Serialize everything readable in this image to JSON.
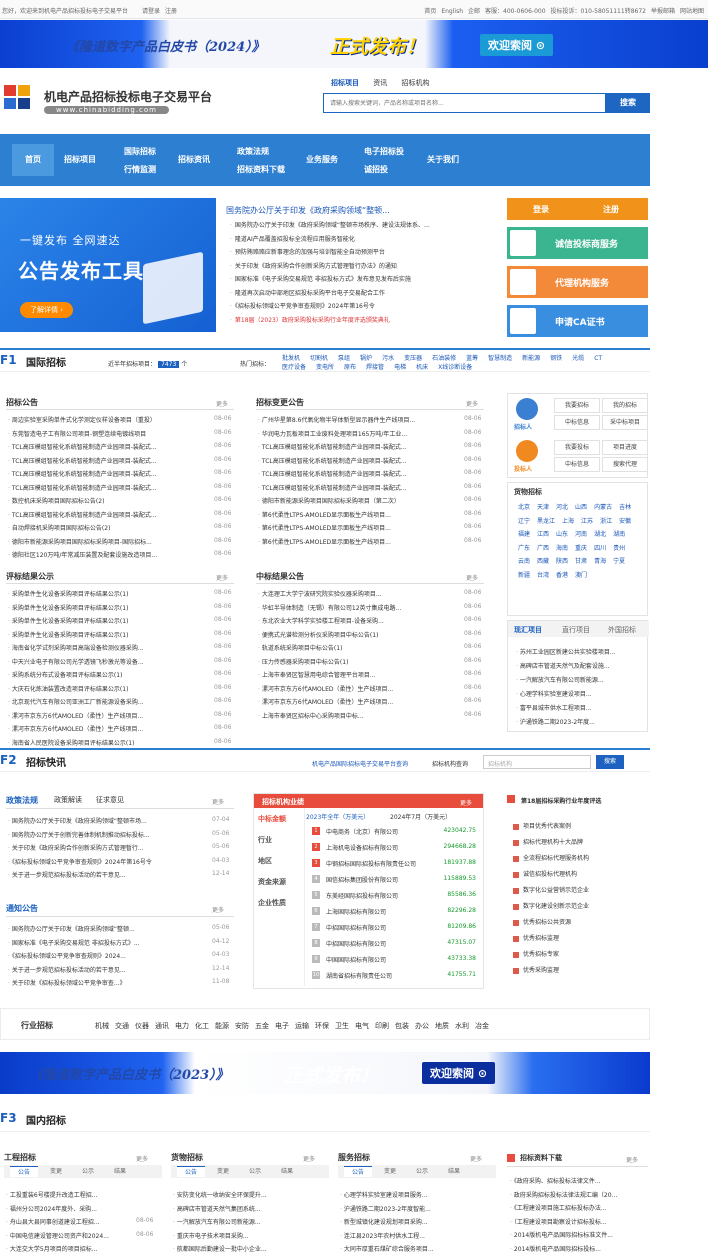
{
  "topbar": {
    "welcome": "您好，欢迎来到机电产品招标投标电子交易平台",
    "login": "请登录",
    "register": "注册",
    "links": [
      "首页",
      "English",
      "企邮",
      "客服：400-0606-000",
      "投标投诉：010-58051111转8672",
      "举报邮箱",
      "网站地图"
    ]
  },
  "banner_top": {
    "title": "《隆道数字产品白皮书（2024）》",
    "big": "正式发布！",
    "button": "欢迎索阅 ⊙"
  },
  "logo": {
    "name": "机电产品招标投标电子交易平台",
    "url": "www.chinabidding.com"
  },
  "search": {
    "tabs": [
      "招标项目",
      "资讯",
      "招标机构"
    ],
    "placeholder": "请输入搜索关键词，产品名称或项目名称...",
    "button": "搜索"
  },
  "nav": {
    "items": [
      "首页",
      "招标项目",
      "国际招标",
      "行情监测",
      "招标资讯",
      "政策法规",
      "招标资料下载",
      "业务服务",
      "电子招标投",
      "诚招投",
      "关于我们"
    ]
  },
  "hero": {
    "line1": "一键发布   全网速达",
    "line2": "公告发布工具",
    "button": "了解详情 ›"
  },
  "news": {
    "title": "国务院办公厅关于印发《政府采购领域“整顿...",
    "items": [
      "国务院办公厅关于印发《政府采购领域“整顿市场秩序、建设法规体系、...",
      "隆道AI产品覆盖招投标全流程应用服务智能化",
      "预防贿赂赂应新事理念的加强与培训智能全自动预测平台",
      "关于印发《政府采购合作创新采购方式管理暂行办法》的通知",
      "国家标准《电子采购交易规范 非招投标方式》发布意见发布后实施",
      "隆道再次启动中部地区招投标采购平台电子交易配合工作",
      "《招标投标领域公平竞争审查规则》2024年第16号令"
    ],
    "red": "第18届（2023）政府采购投标采购行业年度评选颁奖典礼"
  },
  "user": {
    "login": "登录",
    "register": "注册",
    "services": [
      "诚信投标商服务",
      "代理机构服务",
      "申请CA证书"
    ]
  },
  "f1": {
    "code": "F1",
    "name": "国际招标",
    "stat_label": "近半年招标项目：",
    "stat_value": "7473",
    "stat_unit": "个",
    "hot_label": "热门招标：",
    "hot": [
      "批发机",
      "切割机",
      "泵组",
      "锅炉",
      "污水",
      "变压器",
      "石油装修",
      "蓝筹",
      "智慧制造",
      "新能源",
      "钢铁",
      "光缆",
      "CT",
      "医疗设备",
      "变电所",
      "原布",
      "焊接管",
      "电梯",
      "机床",
      "X线诊断设备"
    ]
  },
  "tender": {
    "title": "招标公告",
    "more": "更多",
    "rows": [
      "周边实验室采购单件式化学测定仪样设备项目（重投）",
      "东莞智造电子工有限公司项目-钢塑连续电镀线项目",
      "TCL高压模组智能化系统智能制造产业园项目-装配式...",
      "TCL高压模组智能化系统智能制造产业园项目-装配式...",
      "TCL高压模组智能化系统智能制造产业园项目-装配式...",
      "TCL高压模组智能化系统智能制造产业园项目-装配式...",
      "数控机床采购项目国际招标公告(2)",
      "TCL高压模组智能化系统智能制造产业园项目-装配式...",
      "自动焊接机采购项目国际招标公告(2)",
      "德阳市新能源采购项目国际招标采购项目-国际招标...",
      "德阳社区120万吨/年常减压装置及配套设施改造项目..."
    ],
    "dates": [
      "08-06",
      "08-06",
      "08-06",
      "08-06",
      "08-06",
      "08-06",
      "08-06",
      "08-06",
      "08-06",
      "08-06",
      "08-06"
    ]
  },
  "change": {
    "title": "招标变更公告",
    "more": "更多",
    "rows": [
      "广州华星第8.6代氧化物半导体新型显示器件生产线项目...",
      "华润电力瓦板项目工业废料处理项目165万吨/年工业...",
      "TCL高压模组智能化系统智能制造产业园项目-装配式...",
      "TCL高压模组智能化系统智能制造产业园项目-装配式...",
      "TCL高压模组智能化系统智能制造产业园项目-装配式...",
      "TCL高压模组智能化系统智能制造产业园项目-装配式...",
      "德阳市新能源采购项目国际招标采购项目（第二次）",
      "第6代柔性LTPS-AMOLED显示面板生产线项目...",
      "第6代柔性LTPS-AMOLED显示面板生产线项目...",
      "第6代柔性LTPS-AMOLED显示面板生产线项目..."
    ],
    "dates": [
      "08-06",
      "08-06",
      "08-06",
      "08-06",
      "08-06",
      "08-06",
      "08-06",
      "08-06",
      "08-06",
      "08-06"
    ]
  },
  "result": {
    "title": "评标结果公示",
    "more": "更多",
    "rows": [
      "采购单件生化设备采购项目评标结果公示(1)",
      "采购单件生化设备采购项目评标结果公示(1)",
      "采购单件生化设备采购项目评标结果公示(1)",
      "采购单件生化设备采购项目评标结果公示(1)",
      "海南省化学试剂采购项目高端设备检测仪器采购...",
      "中天兴业电子有限公司光学透镜飞秒激光等设备...",
      "采购系统分布式设备项目评标结果公示(1)",
      "大庆石化炼油装置改造项目评标结果公示(1)",
      "北京现代汽车有限公司亚洲工厂新能源设备采购...",
      "漯河市京东方6代AMOLED（柔性）生产线项目...",
      "漯河市京东方6代AMOLED（柔性）生产线项目...",
      "海南省人民医院设备采购项目评标结果公示(1)"
    ],
    "dates": [
      "08-06",
      "08-06",
      "08-06",
      "08-06",
      "08-06",
      "08-06",
      "08-06",
      "08-06",
      "08-06",
      "08-06",
      "08-06",
      "08-06"
    ]
  },
  "award": {
    "title": "中标结果公告",
    "more": "更多",
    "rows": [
      "大连理工大学宁波研究院实验仪器采购项目...",
      "华虹半导体制造（无锡）有限公司12英寸集成电路...",
      "东北农业大学科学实验楼工程项目-设备采购...",
      "便携式光谱检测分析仪采购项目中标公告(1)",
      "轨道系统采购项目中标公告(1)",
      "压力传感器采购项目中标公告(1)",
      "上海市奉贤区智慧用电综合管理平台项目...",
      "漯河市京东方6代AMOLED（柔性）生产线项目...",
      "漯河市京东方6代AMOLED（柔性）生产线项目...",
      "上海市奉贤区招标中心采购项目中标..."
    ],
    "dates": [
      "08-06",
      "08-06",
      "08-06",
      "08-06",
      "08-06",
      "08-06",
      "08-06",
      "08-06",
      "08-06",
      "08-06"
    ]
  },
  "side": {
    "tender_label": "招标人",
    "bidder_label": "投标人",
    "tender_btns": [
      "我要招标",
      "我的招标",
      "中标信息",
      "采中标项目"
    ],
    "bidder_btns": [
      "我要投标",
      "项目进度",
      "中标信息",
      "搜索代理"
    ],
    "region_title": "货物招标",
    "regions": [
      "北京",
      "天津",
      "河北",
      "山西",
      "内蒙古",
      "吉林",
      "辽宁",
      "黑龙江",
      "上海",
      "江苏",
      "浙江",
      "安徽",
      "福建",
      "江西",
      "山东",
      "河南",
      "湖北",
      "湖南",
      "广东",
      "广西",
      "海南",
      "重庆",
      "四川",
      "贵州",
      "云南",
      "西藏",
      "陕西",
      "甘肃",
      "青海",
      "宁夏",
      "新疆",
      "台湾",
      "香港",
      "澳门"
    ],
    "tabs": [
      "现汇项目",
      "直行项目",
      "外国招标"
    ],
    "items": [
      "苏州工业园区新建公共实验楼项目...",
      "高碑店市管道天然气及配套设施...",
      "一汽解放汽车有限公司新能源...",
      "心理学科实验室建设项目...",
      "富平县城市供水工程项目...",
      "沪通铁路二期2023-2年度..."
    ]
  },
  "f2": {
    "code": "F2",
    "name": "招标快讯",
    "search_hint": "机电产品国际招标电子交易平台查询",
    "search_label": "招标机构查询",
    "search_placeholder": "招标机构",
    "search_button": "搜索"
  },
  "policy": {
    "tabs": [
      "政策法规",
      "政策解读",
      "征求意见"
    ],
    "more": "更多",
    "rows": [
      "国务院办公厅关于印发《政府采购领域“整顿市场...",
      "国务院办公厅关于创新完善体制机制推动招标投标...",
      "关于印发《政府采购合作创新采购方式管理暂行...",
      "《招标投标领域公平竞争审查规则》2024年第16号令",
      "关于进一步规范招标投标活动的若干意见..."
    ],
    "dates": [
      "07-04",
      "05-06",
      "05-06",
      "04-03",
      "12-14"
    ]
  },
  "notice": {
    "title": "通知公告",
    "more": "更多",
    "rows": [
      "国务院办公厅关于印发《政府采购领域“整顿...",
      "国家标准《电子采购交易规范 非招投标方式》...",
      "《招标投标领域公平竞争审查规则》2024...",
      "关于进一步规范招标投标活动的若干意见...",
      "关于印发《招标投标领域公平竞争审查...》"
    ],
    "dates": [
      "05-06",
      "04-12",
      "04-03",
      "12-14",
      "11-08"
    ]
  },
  "ranking": {
    "title": "招标机构业绩",
    "more": "更多",
    "year_tabs": [
      "2023年全年（万美元）",
      "2024年7月（万美元）"
    ],
    "cats": [
      "中标金额",
      "行业",
      "地区",
      "资金来源",
      "企业性质"
    ],
    "rows": [
      {
        "n": "1",
        "c": "中电商务（北京）有限公司",
        "v": "423042.75"
      },
      {
        "n": "2",
        "c": "上海机电设备招标有限公司",
        "v": "294668.28"
      },
      {
        "n": "3",
        "c": "中钢招标国际招投标有限责任公司",
        "v": "181937.88"
      },
      {
        "n": "4",
        "c": "国信招标集团股份有限公司",
        "v": "115889.53"
      },
      {
        "n": "5",
        "c": "东美经国际招投标有限公司",
        "v": "85586.36"
      },
      {
        "n": "6",
        "c": "上海国际招标有限公司",
        "v": "82296.28"
      },
      {
        "n": "7",
        "c": "中招国际招标有限公司",
        "v": "81209.86"
      },
      {
        "n": "8",
        "c": "中招国际招标有限公司",
        "v": "47315.07"
      },
      {
        "n": "9",
        "c": "中国国际招标有限公司",
        "v": "43733.38"
      },
      {
        "n": "10",
        "c": "湖南省招标有限责任公司",
        "v": "41755.71"
      }
    ]
  },
  "awards": {
    "title": "第18届招标采购行业年度评选",
    "items": [
      "项目优秀代表案例",
      "招标代理机构十大品牌",
      "全流程招标代理服务机构",
      "诚信招投标代理机构",
      "数字化公益营销示范企业",
      "数字化建设创新示范企业",
      "优秀招标公共资源",
      "优秀招标监理",
      "优秀招标专家",
      "优秀采购监理"
    ]
  },
  "industry": {
    "title": "行业招标",
    "items": [
      "机械",
      "交通",
      "仪器",
      "通讯",
      "电力",
      "化工",
      "能源",
      "安防",
      "五金",
      "电子",
      "运输",
      "环保",
      "卫生",
      "电气",
      "印刷",
      "包装",
      "办公",
      "地质",
      "水利",
      "冶金"
    ]
  },
  "banner_bottom": {
    "title": "《隆道数字产品白皮书（2023）》",
    "big": "正式发布！",
    "button": "欢迎索阅 ⊙"
  },
  "f3": {
    "code": "F3",
    "name": "国内招标"
  },
  "domestic": [
    {
      "title": "工程招标",
      "more": "更多",
      "tabs": [
        "公告",
        "变更",
        "公示",
        "结果"
      ],
      "rows": [
        "工投重装6号楼提升改造工程招...",
        "福州分公司2024年度外、采购...",
        "舟山县大县同事创道建设工程招...",
        "中国电信建设管理公司资产和2024...",
        "大连交大学5月项目的项目招标..."
      ],
      "dates": [
        "",
        "",
        "08-06",
        "08-06",
        ""
      ]
    },
    {
      "title": "货物招标",
      "more": "更多",
      "tabs": [
        "公告",
        "变更",
        "公示",
        "结果"
      ],
      "rows": [
        "安防变化统一收纳安全环保提升...",
        "高碑店市管道天然气集团系统...",
        "一汽解放汽车有限公司新能源...",
        "重庆市电子技术项目采购...",
        "航都国际后勤建设一批中小企业..."
      ],
      "dates": [
        "",
        "",
        "",
        "",
        ""
      ]
    },
    {
      "title": "服务招标",
      "more": "更多",
      "tabs": [
        "公告",
        "变更",
        "公示",
        "结果"
      ],
      "rows": [
        "心理学科实验室建设项目服务...",
        "沪通铁路二期2023-2年度智能...",
        "新型城镇化建设规划项目采购...",
        "连江县2023年农村供水工程...",
        "大同市厚重石煤矿综合服务项目..."
      ],
      "dates": [
        "",
        "",
        "",
        "",
        ""
      ]
    }
  ],
  "downloads": {
    "title": "招标资料下载",
    "more": "更多",
    "items": [
      "《政府采购、招标投标法律文件...",
      "政府采购招标投标法律法规汇编（20...",
      "《工程建设项目施工招标投标办法...",
      "（工程建设项目勘察设计招标投标...",
      "2014版机电产品国际招标标准文件...",
      "2014版机电产品国际招标投标..."
    ]
  }
}
